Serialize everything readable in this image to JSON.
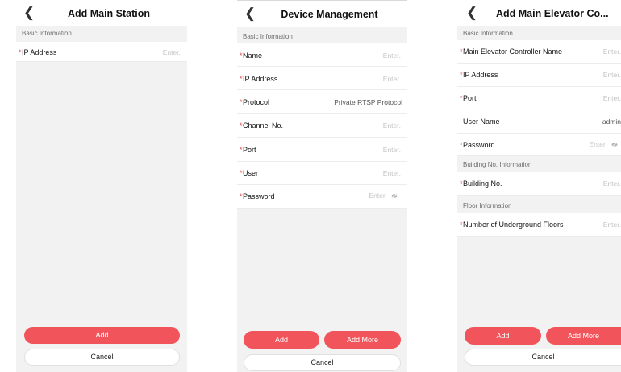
{
  "screen1": {
    "title": "Add Main Station",
    "back_icon": "chevron-left-icon",
    "section_basic": "Basic Information",
    "fields": [
      {
        "label": "IP Address",
        "required": true,
        "placeholder": "Enter."
      }
    ],
    "add_label": "Add",
    "cancel_label": "Cancel"
  },
  "screen2": {
    "title": "Device Management",
    "back_icon": "chevron-left-icon",
    "section_basic": "Basic Information",
    "fields": [
      {
        "label": "Name",
        "required": true,
        "placeholder": "Enter."
      },
      {
        "label": "IP Address",
        "required": true,
        "placeholder": "Enter."
      },
      {
        "label": "Protocol",
        "required": true,
        "value": "Private RTSP Protocol"
      },
      {
        "label": "Channel No.",
        "required": true,
        "placeholder": "Enter."
      },
      {
        "label": "Port",
        "required": true,
        "placeholder": "Enter."
      },
      {
        "label": "User",
        "required": true,
        "placeholder": "Enter."
      },
      {
        "label": "Password",
        "required": true,
        "placeholder": "Enter."
      }
    ],
    "add_label": "Add",
    "add_more_label": "Add More",
    "cancel_label": "Cancel"
  },
  "screen3": {
    "title": "Add Main Elevator Co...",
    "back_icon": "chevron-left-icon",
    "section_basic": "Basic Information",
    "fields": [
      {
        "label": "Main Elevator Controller Name",
        "required": true,
        "placeholder": "Enter."
      },
      {
        "label": "IP Address",
        "required": true,
        "placeholder": "Enter."
      },
      {
        "label": "Port",
        "required": true,
        "placeholder": "Enter."
      },
      {
        "label": "User Name",
        "required": false,
        "value": "admin"
      },
      {
        "label": "Password",
        "required": true,
        "placeholder": "Enter."
      }
    ],
    "section_building": "Building No. Information",
    "building_field": {
      "label": "Building No.",
      "required": true,
      "placeholder": "Enter."
    },
    "section_floor": "Floor Information",
    "floor_field": {
      "label": "Number of Underground Floors",
      "required": true,
      "placeholder": "Enter."
    },
    "add_label": "Add",
    "add_more_label": "Add More",
    "cancel_label": "Cancel"
  },
  "colors": {
    "accent": "#f2545b",
    "required": "#e84c4c",
    "background": "#f2f2f2"
  }
}
